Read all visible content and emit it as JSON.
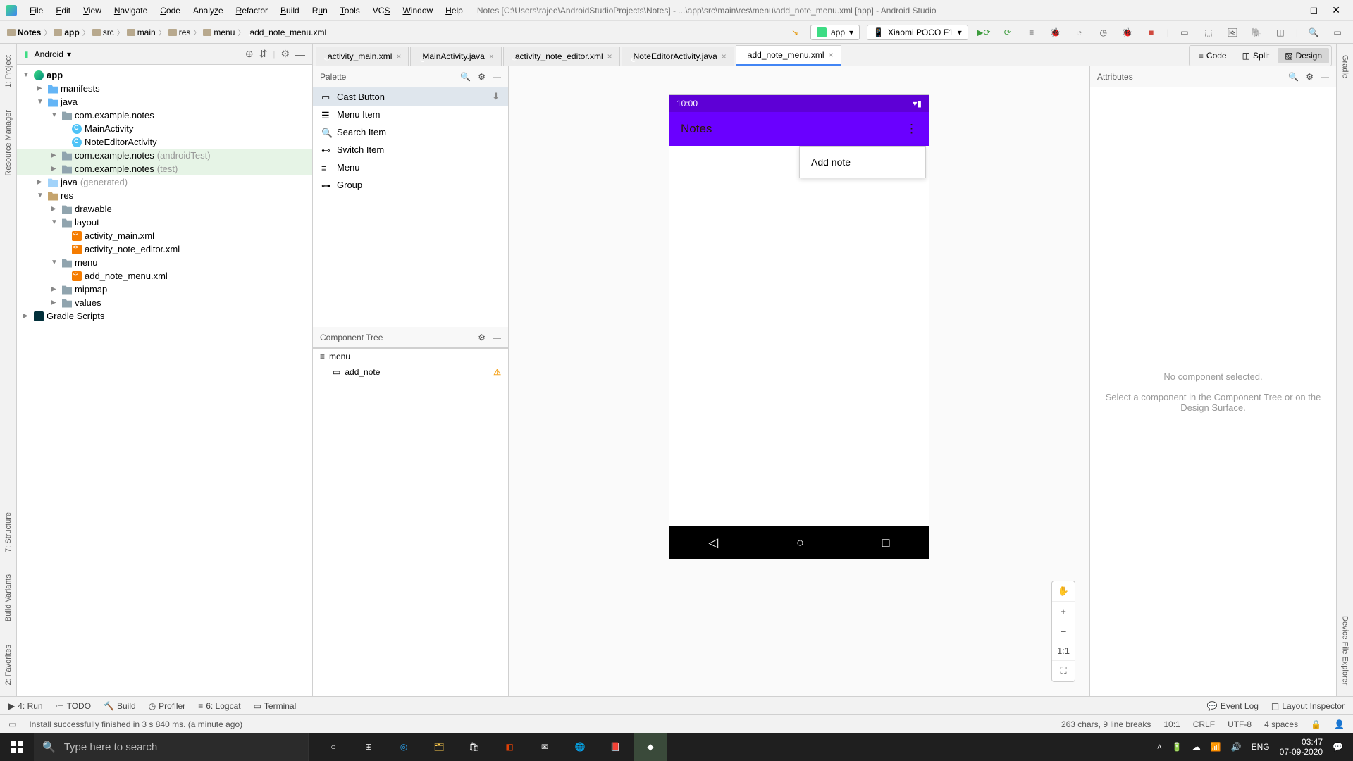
{
  "titlebar": {
    "menus": [
      "File",
      "Edit",
      "View",
      "Navigate",
      "Code",
      "Analyze",
      "Refactor",
      "Build",
      "Run",
      "Tools",
      "VCS",
      "Window",
      "Help"
    ],
    "title": "Notes [C:\\Users\\rajee\\AndroidStudioProjects\\Notes] - ...\\app\\src\\main\\res\\menu\\add_note_menu.xml [app] - Android Studio"
  },
  "breadcrumbs": [
    "Notes",
    "app",
    "src",
    "main",
    "res",
    "menu",
    "add_note_menu.xml"
  ],
  "run_config": {
    "app_label": "app",
    "device_label": "Xiaomi POCO F1"
  },
  "left_strip": [
    "1: Project",
    "Resource Manager"
  ],
  "right_strip_top": [
    "Gradle"
  ],
  "right_strip_bottom": [
    "Device File Explorer"
  ],
  "left_bottom_strip": [
    "Build Variants",
    "2: Favorites",
    "7: Structure"
  ],
  "project": {
    "mode": "Android",
    "tree": {
      "app": "app",
      "manifests": "manifests",
      "java": "java",
      "pkg": "com.example.notes",
      "main_activity": "MainActivity",
      "note_editor_activity": "NoteEditorActivity",
      "pkg_android_test": "com.example.notes",
      "pkg_android_test_hint": "(androidTest)",
      "pkg_test": "com.example.notes",
      "pkg_test_hint": "(test)",
      "java_gen": "java",
      "java_gen_hint": "(generated)",
      "res": "res",
      "drawable": "drawable",
      "layout": "layout",
      "activity_main_xml": "activity_main.xml",
      "activity_note_editor_xml": "activity_note_editor.xml",
      "menu_dir": "menu",
      "add_note_menu_xml": "add_note_menu.xml",
      "mipmap": "mipmap",
      "values": "values",
      "gradle_scripts": "Gradle Scripts"
    }
  },
  "editor_tabs": [
    {
      "label": "activity_main.xml",
      "type": "xml"
    },
    {
      "label": "MainActivity.java",
      "type": "class"
    },
    {
      "label": "activity_note_editor.xml",
      "type": "xml"
    },
    {
      "label": "NoteEditorActivity.java",
      "type": "class"
    },
    {
      "label": "add_note_menu.xml",
      "type": "xml",
      "active": true
    }
  ],
  "view_modes": {
    "code": "Code",
    "split": "Split",
    "design": "Design"
  },
  "palette": {
    "title": "Palette",
    "items": [
      "Cast Button",
      "Menu Item",
      "Search Item",
      "Switch Item",
      "Menu",
      "Group"
    ]
  },
  "component_tree": {
    "title": "Component Tree",
    "root": "menu",
    "child": "add_note"
  },
  "preview": {
    "status_time": "10:00",
    "app_title": "Notes",
    "menu_item": "Add note"
  },
  "zoom": {
    "ratio": "1:1"
  },
  "attributes": {
    "title": "Attributes",
    "msg1": "No component selected.",
    "msg2": "Select a component in the Component Tree or on the Design Surface."
  },
  "bottom_tools": {
    "run": "4: Run",
    "todo": "TODO",
    "build": "Build",
    "profiler": "Profiler",
    "logcat": "6: Logcat",
    "terminal": "Terminal",
    "event_log": "Event Log",
    "layout_inspector": "Layout Inspector"
  },
  "statusbar": {
    "msg": "Install successfully finished in 3 s 840 ms. (a minute ago)",
    "chars": "263 chars, 9 line breaks",
    "pos": "10:1",
    "le": "CRLF",
    "enc": "UTF-8",
    "indent": "4 spaces"
  },
  "taskbar": {
    "search_placeholder": "Type here to search",
    "lang": "ENG",
    "time": "03:47",
    "date": "07-09-2020"
  }
}
